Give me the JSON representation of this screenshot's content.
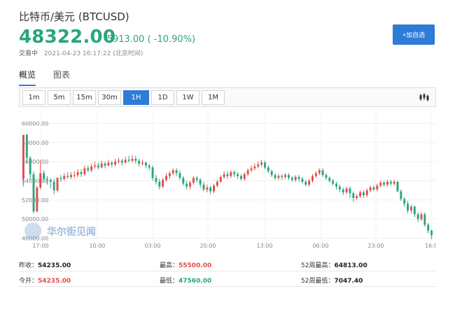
{
  "header": {
    "title": "比特币/美元 (BTCUSD)",
    "price": "48322.00",
    "change": "-5913.00 ( -10.90%)",
    "status": "交易中",
    "timestamp": "2021-04-23 16:17:22 (北京时间)",
    "add_label": "+加自选"
  },
  "tabs": [
    {
      "label": "概览",
      "active": true
    },
    {
      "label": "图表",
      "active": false
    }
  ],
  "periods": [
    {
      "label": "1m",
      "active": false
    },
    {
      "label": "5m",
      "active": false
    },
    {
      "label": "15m",
      "active": false
    },
    {
      "label": "30m",
      "active": false
    },
    {
      "label": "1H",
      "active": true
    },
    {
      "label": "1D",
      "active": false
    },
    {
      "label": "1W",
      "active": false
    },
    {
      "label": "1M",
      "active": false
    }
  ],
  "chart": {
    "watermark": "华尔街见闻",
    "y_ticks": [
      "60000.00",
      "58000.00",
      "56000.00",
      "54000.00",
      "52000.00",
      "50000.00",
      "48000.00"
    ],
    "x_ticks": [
      "17:00",
      "10:00",
      "03:00",
      "20:00",
      "13:00",
      "06:00",
      "23:00",
      "16:0"
    ]
  },
  "chart_data": {
    "type": "candlestick",
    "title": "",
    "ylim": [
      47600,
      61200
    ],
    "candles": [
      [
        54235,
        58800,
        58800,
        53400
      ],
      [
        58800,
        56400,
        58900,
        55900
      ],
      [
        56400,
        54700,
        56600,
        54100
      ],
      [
        54700,
        50800,
        55000,
        50600
      ],
      [
        50800,
        53300,
        53500,
        50700
      ],
      [
        53300,
        54800,
        56200,
        53100
      ],
      [
        54800,
        54200,
        55100,
        53900
      ],
      [
        54200,
        54100,
        54500,
        53600
      ],
      [
        54100,
        53900,
        54300,
        53200
      ],
      [
        53900,
        53000,
        54200,
        52600
      ],
      [
        53000,
        54300,
        54400,
        52800
      ],
      [
        54300,
        54200,
        54600,
        53900
      ],
      [
        54200,
        54500,
        54800,
        54000
      ],
      [
        54500,
        54400,
        54900,
        54200
      ],
      [
        54400,
        54600,
        54900,
        54200
      ],
      [
        54600,
        54600,
        55000,
        54300
      ],
      [
        54600,
        54900,
        55200,
        54400
      ],
      [
        54900,
        54700,
        55200,
        54400
      ],
      [
        54700,
        55300,
        55600,
        54500
      ],
      [
        55300,
        55100,
        55600,
        54900
      ],
      [
        55100,
        55500,
        55800,
        54900
      ],
      [
        55500,
        55600,
        56000,
        55300
      ],
      [
        55600,
        55400,
        55900,
        55200
      ],
      [
        55400,
        55800,
        56100,
        55300
      ],
      [
        55800,
        55600,
        56000,
        55300
      ],
      [
        55600,
        55900,
        56200,
        55500
      ],
      [
        55900,
        55700,
        56100,
        55400
      ],
      [
        55700,
        56000,
        56300,
        55500
      ],
      [
        56000,
        56100,
        56400,
        55800
      ],
      [
        56100,
        55900,
        56300,
        55600
      ],
      [
        55900,
        56200,
        56500,
        55800
      ],
      [
        56200,
        56100,
        56600,
        55900
      ],
      [
        56100,
        56300,
        56700,
        55900
      ],
      [
        56300,
        56100,
        56600,
        55800
      ],
      [
        56100,
        55800,
        56300,
        55500
      ],
      [
        55800,
        55900,
        56200,
        55600
      ],
      [
        55900,
        55600,
        56000,
        55300
      ],
      [
        55600,
        55400,
        55800,
        55100
      ],
      [
        55400,
        54300,
        55600,
        54000
      ],
      [
        54300,
        53900,
        54600,
        53600
      ],
      [
        53900,
        53400,
        54200,
        53100
      ],
      [
        53400,
        54100,
        54300,
        53200
      ],
      [
        54100,
        54500,
        54800,
        53900
      ],
      [
        54500,
        54800,
        55000,
        54200
      ],
      [
        54800,
        55100,
        55300,
        54600
      ],
      [
        55100,
        54800,
        55300,
        54500
      ],
      [
        54800,
        54300,
        55100,
        54100
      ],
      [
        54300,
        53700,
        54500,
        53500
      ],
      [
        53700,
        53400,
        54000,
        53100
      ],
      [
        53400,
        53800,
        54000,
        53100
      ],
      [
        53800,
        54300,
        54500,
        53600
      ],
      [
        54300,
        54100,
        54500,
        53800
      ],
      [
        54100,
        53600,
        54300,
        53300
      ],
      [
        53600,
        53100,
        53900,
        52900
      ],
      [
        53100,
        53300,
        53600,
        52800
      ],
      [
        53300,
        52900,
        53500,
        52600
      ],
      [
        52900,
        53500,
        53700,
        52700
      ],
      [
        53500,
        53900,
        54100,
        53300
      ],
      [
        53900,
        54400,
        54600,
        53800
      ],
      [
        54400,
        54700,
        55000,
        54200
      ],
      [
        54700,
        54500,
        55000,
        54200
      ],
      [
        54500,
        54900,
        55100,
        54300
      ],
      [
        54900,
        54700,
        55100,
        54400
      ],
      [
        54700,
        54500,
        54900,
        54200
      ],
      [
        54500,
        54200,
        54700,
        54000
      ],
      [
        54200,
        54700,
        54900,
        54000
      ],
      [
        54700,
        55100,
        55300,
        54500
      ],
      [
        55100,
        55300,
        55600,
        54900
      ],
      [
        55300,
        55500,
        55800,
        55100
      ],
      [
        55500,
        55700,
        56000,
        55300
      ],
      [
        55700,
        55900,
        56200,
        55500
      ],
      [
        55900,
        55400,
        56100,
        55200
      ],
      [
        55400,
        55000,
        55600,
        54800
      ],
      [
        55000,
        54600,
        55200,
        54400
      ],
      [
        54600,
        54300,
        54800,
        54100
      ],
      [
        54300,
        54500,
        54700,
        54100
      ],
      [
        54500,
        54400,
        54700,
        54100
      ],
      [
        54400,
        54600,
        54800,
        54200
      ],
      [
        54600,
        54300,
        54800,
        54100
      ],
      [
        54300,
        54100,
        54500,
        53900
      ],
      [
        54100,
        54400,
        54600,
        53900
      ],
      [
        54400,
        54200,
        54600,
        53900
      ],
      [
        54200,
        53900,
        54400,
        53700
      ],
      [
        53900,
        53600,
        54100,
        53400
      ],
      [
        53600,
        54000,
        54200,
        53400
      ],
      [
        54000,
        54500,
        54700,
        53800
      ],
      [
        54500,
        54800,
        55000,
        54300
      ],
      [
        54800,
        55100,
        55300,
        54600
      ],
      [
        55100,
        54600,
        55300,
        54400
      ],
      [
        54600,
        54300,
        54800,
        54100
      ],
      [
        54300,
        54000,
        54500,
        53800
      ],
      [
        54000,
        53700,
        54200,
        53500
      ],
      [
        53700,
        53400,
        53900,
        53100
      ],
      [
        53400,
        53100,
        53600,
        52800
      ],
      [
        53100,
        52800,
        53300,
        52500
      ],
      [
        52800,
        53200,
        53400,
        52600
      ],
      [
        53200,
        52700,
        53400,
        52200
      ],
      [
        52700,
        52200,
        52900,
        51800
      ],
      [
        52200,
        52400,
        52600,
        52000
      ],
      [
        52400,
        52800,
        53000,
        52200
      ],
      [
        52800,
        52500,
        53000,
        52200
      ],
      [
        52500,
        53000,
        53200,
        52300
      ],
      [
        53000,
        53300,
        53500,
        52800
      ],
      [
        53300,
        53100,
        53500,
        52900
      ],
      [
        53100,
        53500,
        53700,
        52900
      ],
      [
        53500,
        53800,
        54000,
        53300
      ],
      [
        53800,
        53600,
        54000,
        53400
      ],
      [
        53600,
        53900,
        54100,
        53400
      ],
      [
        53900,
        53700,
        54100,
        53500
      ],
      [
        53700,
        53900,
        54100,
        53500
      ],
      [
        53900,
        52900,
        54000,
        52800
      ],
      [
        52900,
        52100,
        53100,
        51900
      ],
      [
        52100,
        51600,
        52300,
        51300
      ],
      [
        51600,
        50900,
        51900,
        50600
      ],
      [
        50900,
        51300,
        51500,
        50600
      ],
      [
        51300,
        50500,
        51400,
        50200
      ],
      [
        50500,
        50000,
        50700,
        49700
      ],
      [
        50000,
        50500,
        50700,
        49800
      ],
      [
        50500,
        49400,
        50700,
        49200
      ],
      [
        49400,
        48800,
        49600,
        48500
      ],
      [
        48800,
        48322,
        48900,
        47900
      ]
    ]
  },
  "stats": {
    "prev_close_label": "昨收：",
    "prev_close": "54235.00",
    "high_label": "最高：",
    "high": "55500.00",
    "high52_label": "52周最高：",
    "high52": "64813.00",
    "open_label": "今开：",
    "open": "54235.00",
    "low_label": "最低：",
    "low": "47560.00",
    "low52_label": "52周最低：",
    "low52": "7047.40"
  },
  "colors": {
    "up": "#e34b4b",
    "down": "#2aa57d",
    "accent": "#2d7cd6"
  }
}
